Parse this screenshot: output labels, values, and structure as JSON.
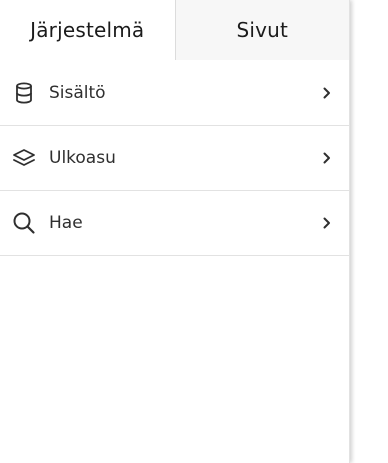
{
  "tabs": [
    {
      "label": "Järjestelmä",
      "active": true
    },
    {
      "label": "Sivut",
      "active": false
    }
  ],
  "menu": {
    "items": [
      {
        "label": "Sisältö",
        "icon": "database-icon"
      },
      {
        "label": "Ulkoasu",
        "icon": "layers-icon"
      },
      {
        "label": "Hae",
        "icon": "search-icon"
      }
    ]
  },
  "colors": {
    "text": "#1b1b1b",
    "label": "#2f2f2f",
    "divider": "#e2e2e2",
    "inactive_tab_bg": "#f7f7f7"
  }
}
